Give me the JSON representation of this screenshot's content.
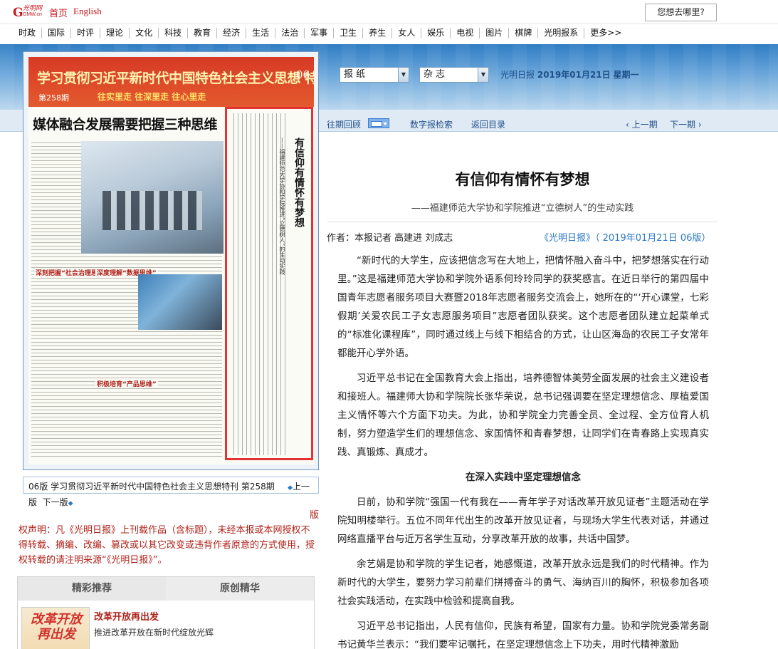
{
  "topbar": {
    "logo_mark": "G",
    "logo_script": "光明网",
    "logo_sub": "GMW.cn",
    "home_link": "首页",
    "english_link": "English",
    "where_button": "您想去哪里?"
  },
  "nav": {
    "items": [
      "时政",
      "国际",
      "时评",
      "理论",
      "文化",
      "科技",
      "教育",
      "经济",
      "生活",
      "法治",
      "军事",
      "卫生",
      "养生",
      "女人",
      "娱乐",
      "电视",
      "图片",
      "棋牌",
      "光明报系",
      "更多>>"
    ]
  },
  "toolbar": {
    "select_paper": "报 纸",
    "select_magazine": "杂 志",
    "date_prefix": "光明日报",
    "date_value": "2019年01月21日",
    "weekday": "星期一",
    "back_issue": "往期回顾",
    "digital_search": "数字报检索",
    "back_to_contents": "返回目录",
    "prev_issue": "‹ 上一期",
    "next_issue": "下一期 ›"
  },
  "paper": {
    "header_title": "学习贯彻习近平新时代中国特色社会主义思想 特刊",
    "issue_no": "第258期",
    "slogan": "往实里走  往深里走  往心里走",
    "page_no": "06",
    "big_headline": "媒体融合发展需要把握三种思维",
    "section_1": "深刻把握“社会治理思维”",
    "section_2": "深度理解“数据思维”",
    "section_3": "积极培育“产品思维”",
    "box_title": "有信仰有情怀有梦想",
    "box_sub": "——福建师范大学协和学院推进“立德树人”的生动实践"
  },
  "caption": {
    "text": "06版 学习贯彻习近平新时代中国特色社会主义思想特刊 第258期",
    "prev": "上一",
    "line2_prefix": "版",
    "next": "下一版"
  },
  "copyright": {
    "lead": "版",
    "text": "权声明：凡《光明日报》上刊载作品（含标题），未经本报或本网授权不得转载、摘编、改编、篡改或以其它改变或违背作者原意的方式使用，授权转载的请注明来源“《光明日报》”。"
  },
  "recommend": {
    "tab_active": "精彩推荐",
    "tab_other": "原创精华",
    "thumb_text": "改革开放 再出发",
    "item_title": "改革开放再出发",
    "item_desc": "推进改革开放在新时代绽放光辉"
  },
  "article": {
    "title": "有信仰有情怀有梦想",
    "subtitle": "——福建师范大学协和学院推进“立德树人”的生动实践",
    "author": "作者：本报记者 高建进 刘成志",
    "source": "《光明日报》（ 2019年01月21日 06版）",
    "p1": "“新时代的大学生，应该把信念写在大地上，把情怀融入奋斗中，把梦想落实在行动里。”这是福建师范大学协和学院外语系何玲玲同学的获奖感言。在近日举行的第四届中国青年志愿者服务项目大赛暨2018年志愿者服务交流会上，她所在的“‘开心课堂，七彩假期’关爱农民工子女志愿服务项目”志愿者团队获奖。这个志愿者团队建立起菜单式的“标准化课程库”，同时通过线上与线下相结合的方式，让山区海岛的农民工子女常年都能开心学外语。",
    "p2": "习近平总书记在全国教育大会上指出，培养德智体美劳全面发展的社会主义建设者和接班人。福建师大协和学院院长张华荣说，总书记强调要在坚定理想信念、厚植爱国主义情怀等六个方面下功夫。为此，协和学院全力完善全员、全过程、全方位育人机制，努力塑造学生们的理想信念、家国情怀和青春梦想，让同学们在青春路上实现真实践、真锻炼、真成才。",
    "subhead": "在深入实践中坚定理想信念",
    "p3": "日前，协和学院“强国一代有我在——青年学子对话改革开放见证者”主题活动在学院知明楼举行。五位不同年代出生的改革开放见证者，与现场大学生代表对话，并通过网络直播平台与近万名学生互动，分享改革开放的故事，共话中国梦。",
    "p4": "余艺娟是协和学院的学生记者，她感慨道，改革开放永远是我们的时代精神。作为新时代的大学生，要努力学习前辈们拼搏奋斗的勇气、海纳百川的胸怀，积极参加各项社会实践活动，在实践中检验和提高自我。",
    "p5": "习近平总书记指出，人民有信仰，民族有希望，国家有力量。协和学院党委常务副书记黄华兰表示：“我们要牢记嘱托，在坚定理想信念上下功夫，用时代精神激励"
  }
}
